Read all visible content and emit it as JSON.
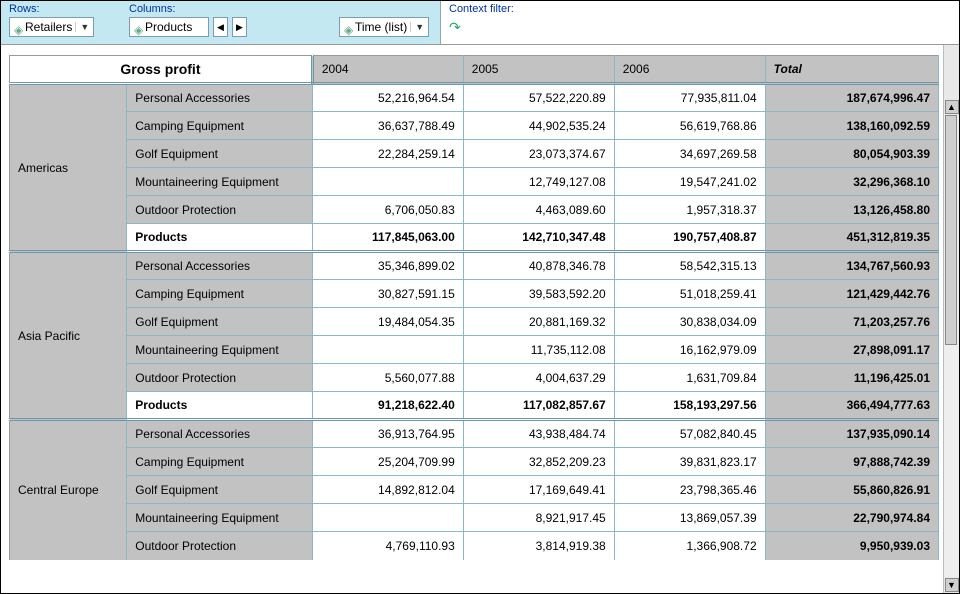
{
  "toolbar": {
    "rows_label": "Rows:",
    "cols_label": "Columns:",
    "context_label": "Context filter:",
    "rows_pill": "Retailers",
    "cols_pill1": "Products",
    "cols_pill2": "Time (list)"
  },
  "table": {
    "corner": "Gross profit",
    "columns": [
      "2004",
      "2005",
      "2006"
    ],
    "total_label": "Total",
    "subtotal_label": "Products",
    "groups": [
      {
        "region": "Americas",
        "rows": [
          {
            "label": "Personal Accessories",
            "v": [
              "52,216,964.54",
              "57,522,220.89",
              "77,935,811.04"
            ],
            "t": "187,674,996.47"
          },
          {
            "label": "Camping Equipment",
            "v": [
              "36,637,788.49",
              "44,902,535.24",
              "56,619,768.86"
            ],
            "t": "138,160,092.59"
          },
          {
            "label": "Golf Equipment",
            "v": [
              "22,284,259.14",
              "23,073,374.67",
              "34,697,269.58"
            ],
            "t": "80,054,903.39"
          },
          {
            "label": "Mountaineering Equipment",
            "v": [
              "",
              "12,749,127.08",
              "19,547,241.02"
            ],
            "t": "32,296,368.10"
          },
          {
            "label": "Outdoor Protection",
            "v": [
              "6,706,050.83",
              "4,463,089.60",
              "1,957,318.37"
            ],
            "t": "13,126,458.80"
          }
        ],
        "subtotal": {
          "v": [
            "117,845,063.00",
            "142,710,347.48",
            "190,757,408.87"
          ],
          "t": "451,312,819.35"
        }
      },
      {
        "region": "Asia Pacific",
        "rows": [
          {
            "label": "Personal Accessories",
            "v": [
              "35,346,899.02",
              "40,878,346.78",
              "58,542,315.13"
            ],
            "t": "134,767,560.93"
          },
          {
            "label": "Camping Equipment",
            "v": [
              "30,827,591.15",
              "39,583,592.20",
              "51,018,259.41"
            ],
            "t": "121,429,442.76"
          },
          {
            "label": "Golf Equipment",
            "v": [
              "19,484,054.35",
              "20,881,169.32",
              "30,838,034.09"
            ],
            "t": "71,203,257.76"
          },
          {
            "label": "Mountaineering Equipment",
            "v": [
              "",
              "11,735,112.08",
              "16,162,979.09"
            ],
            "t": "27,898,091.17"
          },
          {
            "label": "Outdoor Protection",
            "v": [
              "5,560,077.88",
              "4,004,637.29",
              "1,631,709.84"
            ],
            "t": "11,196,425.01"
          }
        ],
        "subtotal": {
          "v": [
            "91,218,622.40",
            "117,082,857.67",
            "158,193,297.56"
          ],
          "t": "366,494,777.63"
        }
      },
      {
        "region": "Central Europe",
        "rows": [
          {
            "label": "Personal Accessories",
            "v": [
              "36,913,764.95",
              "43,938,484.74",
              "57,082,840.45"
            ],
            "t": "137,935,090.14"
          },
          {
            "label": "Camping Equipment",
            "v": [
              "25,204,709.99",
              "32,852,209.23",
              "39,831,823.17"
            ],
            "t": "97,888,742.39"
          },
          {
            "label": "Golf Equipment",
            "v": [
              "14,892,812.04",
              "17,169,649.41",
              "23,798,365.46"
            ],
            "t": "55,860,826.91"
          },
          {
            "label": "Mountaineering Equipment",
            "v": [
              "",
              "8,921,917.45",
              "13,869,057.39"
            ],
            "t": "22,790,974.84"
          },
          {
            "label": "Outdoor Protection",
            "v": [
              "4,769,110.93",
              "3,814,919.38",
              "1,366,908.72"
            ],
            "t": "9,950,939.03"
          }
        ]
      }
    ]
  }
}
